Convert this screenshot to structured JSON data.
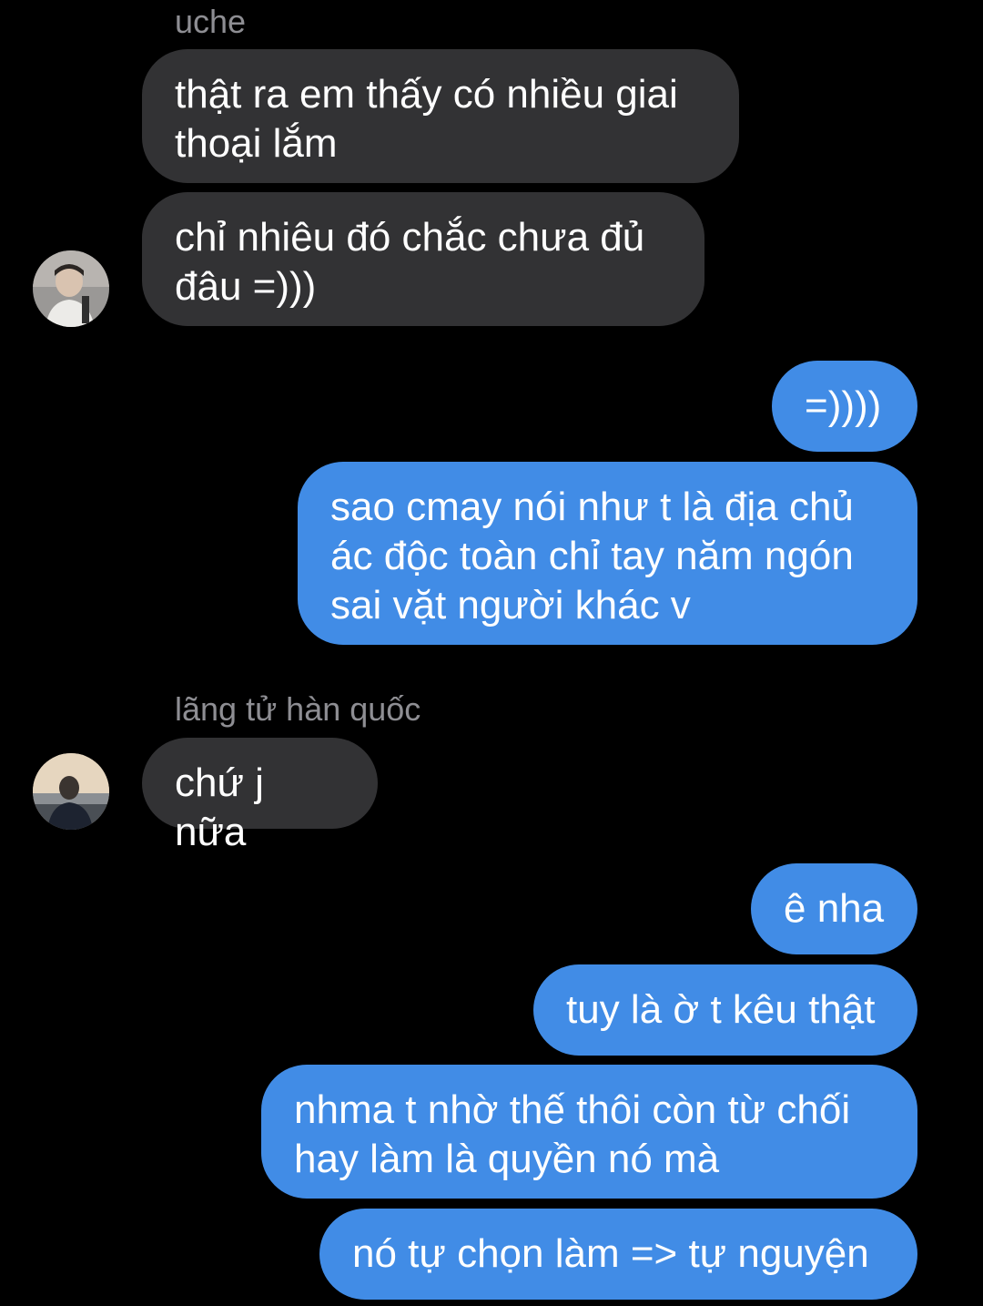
{
  "colors": {
    "background": "#000000",
    "incoming_bubble": "#323234",
    "outgoing_bubble": "#418ce6",
    "sender_name": "#8e8e93"
  },
  "messages": [
    {
      "kind": "sender",
      "text": "uche"
    },
    {
      "kind": "incoming",
      "text": "thật ra em thấy có nhiều giai\nthoại lắm"
    },
    {
      "kind": "incoming",
      "text": "chỉ nhiêu đó chắc chưa đủ\nđâu =)))"
    },
    {
      "kind": "outgoing",
      "text": "=))))"
    },
    {
      "kind": "outgoing",
      "text": "sao cmay nói như t là địa chủ\nác độc toàn chỉ tay năm ngón\nsai vặt người khác v"
    },
    {
      "kind": "sender",
      "text": "lãng tử hàn quốc"
    },
    {
      "kind": "incoming",
      "text": "chứ j nữa"
    },
    {
      "kind": "outgoing",
      "text": "ê nha"
    },
    {
      "kind": "outgoing",
      "text": "tuy là ờ t kêu thật"
    },
    {
      "kind": "outgoing",
      "text": "nhma t nhờ thế thôi còn từ chối\nhay làm là quyền nó mà"
    },
    {
      "kind": "outgoing",
      "text": "nó tự chọn làm => tự nguyện"
    }
  ],
  "avatars": [
    {
      "name": "uche",
      "icon": "avatar-photo"
    },
    {
      "name": "lãng tử hàn quốc",
      "icon": "avatar-photo"
    }
  ]
}
